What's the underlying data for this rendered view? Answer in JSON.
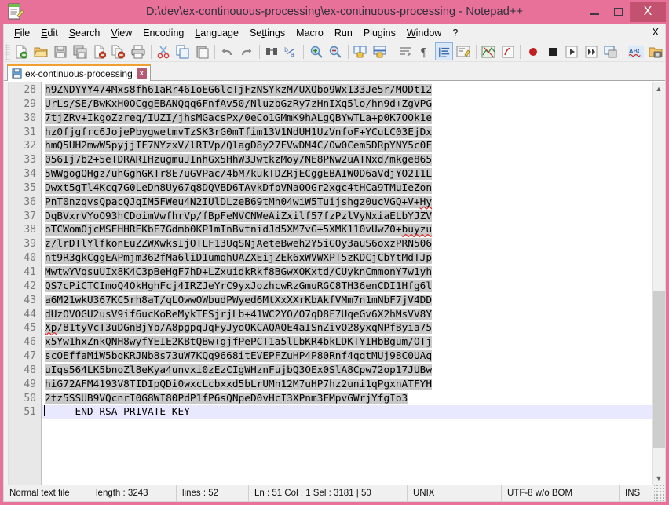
{
  "window": {
    "title": "D:\\dev\\ex-continouous-processing\\ex-continuous-processing - Notepad++",
    "minimize_label": "Minimize",
    "maximize_label": "Maximize",
    "close_label": "X",
    "colors": {
      "titlebar": "#e8719a",
      "close_button": "#c25270",
      "tab_accent": "#f0a030",
      "selection": "#c8c8c8",
      "current_line": "#e8e8ff",
      "spellcheck": "#e03030"
    }
  },
  "menu": {
    "items": [
      {
        "label": "File",
        "accel": "F"
      },
      {
        "label": "Edit",
        "accel": "E"
      },
      {
        "label": "Search",
        "accel": "S"
      },
      {
        "label": "View",
        "accel": "V"
      },
      {
        "label": "Encoding",
        "accel": ""
      },
      {
        "label": "Language",
        "accel": "L"
      },
      {
        "label": "Settings",
        "accel": "t"
      },
      {
        "label": "Macro",
        "accel": ""
      },
      {
        "label": "Run",
        "accel": ""
      },
      {
        "label": "Plugins",
        "accel": ""
      },
      {
        "label": "Window",
        "accel": "W"
      },
      {
        "label": "?",
        "accel": ""
      }
    ],
    "close_document": "X"
  },
  "toolbar": {
    "buttons": [
      "new-file",
      "open-file",
      "save-file",
      "save-all",
      "close-file",
      "close-all",
      "print",
      "cut",
      "copy",
      "paste",
      "undo",
      "redo",
      "find",
      "replace",
      "zoom-in",
      "zoom-out",
      "sync-vertical-scroll",
      "sync-horizontal-scroll",
      "word-wrap",
      "show-all-characters",
      "show-indent-guide",
      "user-defined-dialog",
      "show-document-map",
      "function-list",
      "start-recording",
      "stop-recording",
      "play-macro",
      "play-multiple-macro",
      "save-macro",
      "spell-check",
      "run-macro-dialog"
    ],
    "active_button": "show-indent-guide"
  },
  "tab": {
    "label": "ex-continuous-processing",
    "close_label": "x",
    "saved_state": "saved"
  },
  "editor": {
    "first_line_number": 28,
    "lines": [
      {
        "n": 28,
        "text": "h9ZNDYYY474Mxs8fh61aRr46IoEG6lcTjFzNSYkzM/UXQbo9Wx133Je5r/MODt12",
        "selected": true
      },
      {
        "n": 29,
        "text": "UrLs/SE/BwKxH0OCggEBANQqq6FnfAv50/NluzbGzRy7zHnIXq5lo/hn9d+ZgVPG",
        "selected": true
      },
      {
        "n": 30,
        "text": "7tjZRv+IkgoZzreq/IUZI/jhsMGacsPx/0eCo1GMmK9hALgQBYwTLa+p0K7OOk1e",
        "selected": true
      },
      {
        "n": 31,
        "text": "hz0fjgfrc6JojePbygwetmvTzSK3rG0mTfim13V1NdUH1UzVnfoF+YCuLC03EjDx",
        "selected": true
      },
      {
        "n": 32,
        "text": "hmQ5UH2mwW5pyjjIF7NYzxV/lRTVp/QlagD8y27FVwDM4C/Ow0Cem5DRpYNY5c0F",
        "selected": true
      },
      {
        "n": 33,
        "text": "056Ij7b2+5eTDRARIHzugmuJInhGx5HhW3JwtkzMoy/NE8PNw2uATNxd/mkge865",
        "selected": true
      },
      {
        "n": 34,
        "text": "5WWgogQHgz/uhGghGKTr8E7uGVPac/4bM7kukTDZRjECggEBAIW0D6aVdjYO2I1L",
        "selected": true
      },
      {
        "n": 35,
        "text": "Dwxt5gTl4Kcq7G0LeDn8Uy67q8DQVBD6TAvkDfpVNa0OGr2xgc4tHCa9TMuIeZon",
        "selected": true
      },
      {
        "n": 36,
        "text": "PnT0nzqvsQpacQJqIM5FWeu4N2IUlDLzeB69tMh04wiW5Tuijshgz0ucVGQ+V+Hy",
        "selected": true,
        "spell": "Hy"
      },
      {
        "n": 37,
        "text": "DqBVxrVYoO93hCDoimVwfhrVp/fBpFeNVCNWeAiZxilf57fzPzlVyNxiaELbYJZV",
        "selected": true
      },
      {
        "n": 38,
        "text": "oTCWomOjcMSEHHREKbF7Gdmb0KP1mInBvtnidJd5XM7vG+5XMK110vUwZ0+buyzu",
        "selected": true,
        "spell": "buyzu"
      },
      {
        "n": 39,
        "text": "z/lrDTlYlfkonEuZZWXwksIjOTLF13UqSNjAeteBweh2Y5iGOy3auS6oxzPRN506",
        "selected": true
      },
      {
        "n": 40,
        "text": "nt9R3gkCggEAPmjm362fMa6liD1umqhUAZXEijZEk6xWVWXPT5zKDCjCbYtMdTJp",
        "selected": true
      },
      {
        "n": 41,
        "text": "MwtwYVqsuUIx8K4C3pBeHgF7hD+LZxuidkRkf8BGwXOKxtd/CUyknCmmonY7w1yh",
        "selected": true
      },
      {
        "n": 42,
        "text": "QS7cPiCTCImoQ4OkHghFcj4IRZJeYrC9yxJozhcwRzGmuRGC8TH36enCDI1Hfg6l",
        "selected": true
      },
      {
        "n": 43,
        "text": "a6M21wkU367KC5rh8aT/qLOwwOWbudPWyed6MtXxXXrKbAkfVMm7n1mNbF7jV4DD",
        "selected": true
      },
      {
        "n": 44,
        "text": "dUzOVOGU2usV9if6ucKoReMykTFSjrjLb+41WC2YO/O7qD8F7UqeGv6X2hMsVV8Y",
        "selected": true
      },
      {
        "n": 45,
        "text": "Xp/81tyVcT3uDGnBjYb/A8pgpqJqFyJyoQKCAQAQE4aISnZivQ28yxqNPfByia75",
        "selected": true,
        "spell": "Xp"
      },
      {
        "n": 46,
        "text": "x5Yw1hxZnkQNH8wyfYEIE2KBtQBw+gjfPePCT1a5lLbKR4bkLDKTYIHbBgum/OTj",
        "selected": true
      },
      {
        "n": 47,
        "text": "scOEffaMiW5bqKRJNb8s73uW7KQq9668itEVEPFZuHP4P80Rnf4qqtMUj98C0UAq",
        "selected": true
      },
      {
        "n": 48,
        "text": "uIqs564LK5bnoZl8eKya4unvxi0zEzCIgWHznFujbQ3OEx0SlA8Cpw72op17JUBw",
        "selected": true
      },
      {
        "n": 49,
        "text": "hiG72AFM4193V8TIDIpQDi0wxcLcbxxd5bLrUMn12M7uHP7hz2uni1qPgxnATFYH",
        "selected": true
      },
      {
        "n": 50,
        "text": "2tz5SSUB9VQcnrI0G8WI80PdP1fP6sQNpeD0vHcI3XPnm3FMpvGWrjYfgIo3",
        "selected": true
      },
      {
        "n": 51,
        "text": "-----END RSA PRIVATE KEY-----",
        "selected": false,
        "current": true
      }
    ]
  },
  "statusbar": {
    "file_type": "Normal text file",
    "length": "length : 3243",
    "lines": "lines : 52",
    "position": "Ln : 51   Col : 1   Sel : 3181 | 50",
    "eol": "UNIX",
    "encoding": "UTF-8 w/o BOM",
    "insert_mode": "INS"
  }
}
